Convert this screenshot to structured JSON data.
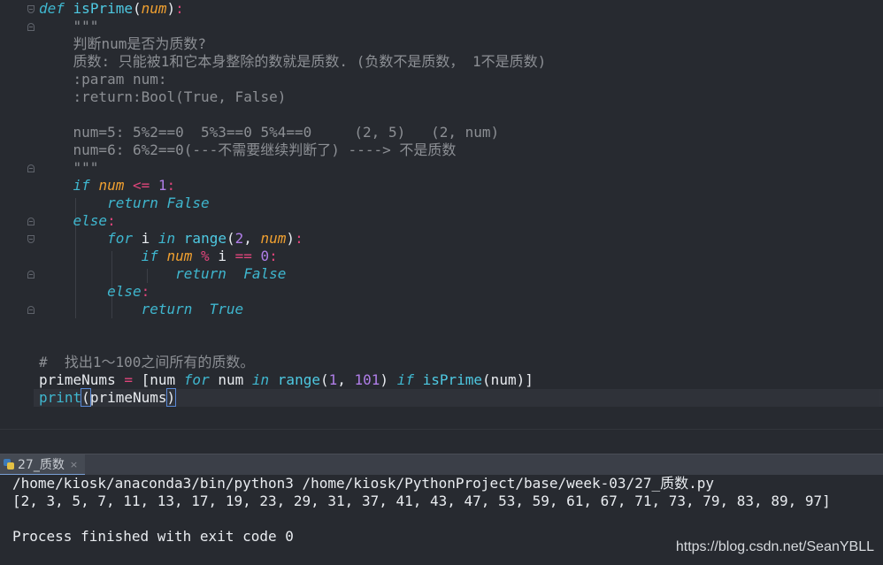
{
  "code": {
    "l1": {
      "def": "def",
      "name": "isPrime",
      "param": "num"
    },
    "doc_open": "\"\"\"",
    "doc1": "判断num是否为质数?",
    "doc2": "质数: 只能被1和它本身整除的数就是质数. (负数不是质数， 1不是质数)",
    "doc3": ":param num:",
    "doc4": ":return:Bool(True, False)",
    "doc5": "num=5: 5%2==0  5%3==0 5%4==0     (2, 5)   (2, num)",
    "doc6": "num=6: 6%2==0(---不需要继续判断了) ----> 不是质数",
    "doc_close": "\"\"\"",
    "if1": {
      "kw": "if",
      "param": "num",
      "op": "<=",
      "num": "1",
      "colon": ":"
    },
    "ret1": {
      "kw": "return",
      "val": "False"
    },
    "else1": {
      "kw": "else",
      "colon": ":"
    },
    "for1": {
      "kw": "for",
      "var": "i",
      "in": "in",
      "fn": "range",
      "n": "2",
      "param": "num"
    },
    "if2": {
      "kw": "if",
      "param": "num",
      "op": "%",
      "var": "i",
      "eq": "==",
      "zero": "0"
    },
    "ret2": {
      "kw": "return",
      "val": "False"
    },
    "else2": {
      "kw": "else",
      "colon": ":"
    },
    "ret3": {
      "kw": "return",
      "val": "True"
    },
    "comment": "#  找出1～100之间所有的质数。",
    "assign": {
      "lhs": "primeNums",
      "eq": "=",
      "open": "[num",
      "for": "for",
      "var": "num",
      "in": "in",
      "range": "range",
      "a": "1",
      "b": "101",
      "if": "if",
      "fn": "isPrime",
      "arg": "(num)]"
    },
    "print": {
      "fn": "print",
      "arg": "primeNums"
    }
  },
  "run": {
    "tab_label": "27_质数",
    "close": "×",
    "cmd": "/home/kiosk/anaconda3/bin/python3 /home/kiosk/PythonProject/base/week-03/27_质数.py",
    "output": "[2, 3, 5, 7, 11, 13, 17, 19, 23, 29, 31, 37, 41, 43, 47, 53, 59, 61, 67, 71, 73, 79, 83, 89, 97]",
    "exit": "Process finished with exit code 0"
  },
  "watermark": "https://blog.csdn.net/SeanYBLL",
  "colors": {
    "keyword": "#3fb7cf",
    "param": "#f0a030",
    "operator": "#e0457b",
    "number": "#b07ee8",
    "docstring": "#8c8f94"
  }
}
